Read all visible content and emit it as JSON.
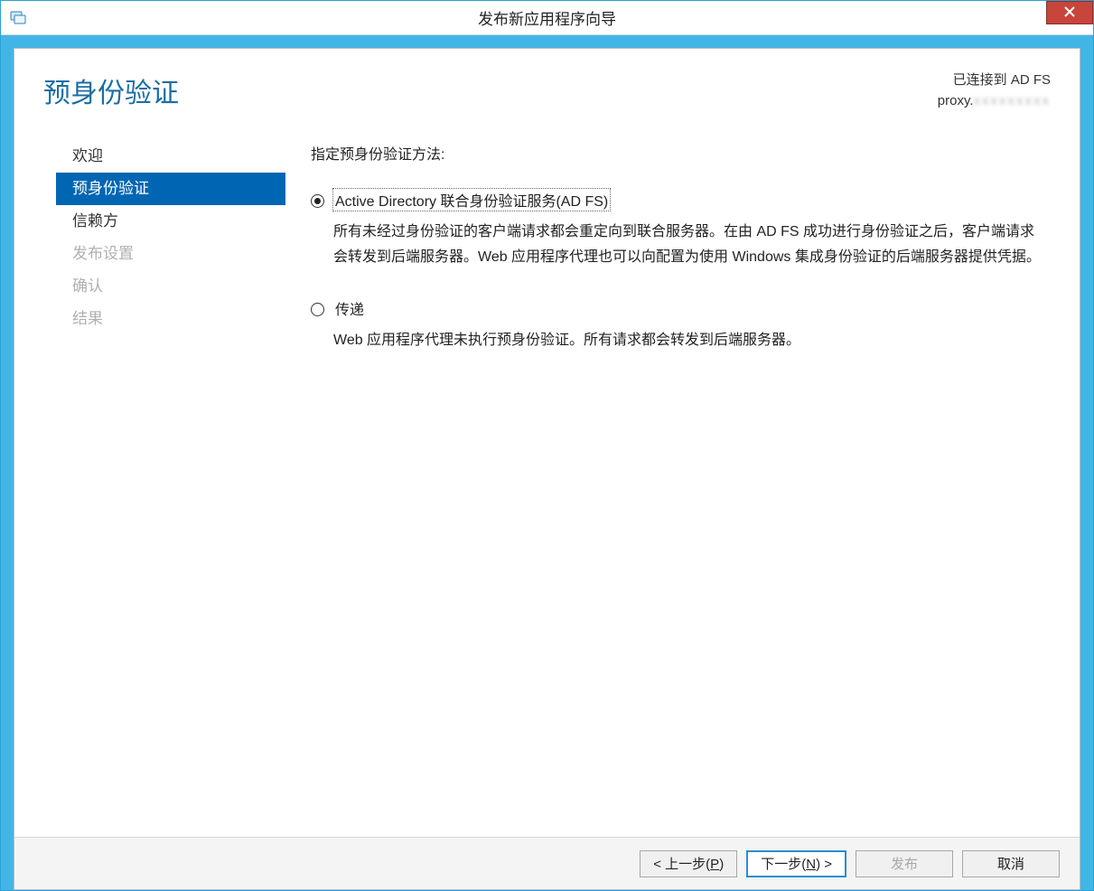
{
  "window": {
    "title": "发布新应用程序向导"
  },
  "header": {
    "page_title": "预身份验证",
    "status_line1": "已连接到 AD FS",
    "status_line2_prefix": "proxy."
  },
  "sidebar": {
    "steps": [
      {
        "label": "欢迎",
        "state": "done"
      },
      {
        "label": "预身份验证",
        "state": "active"
      },
      {
        "label": "信赖方",
        "state": "done"
      },
      {
        "label": "发布设置",
        "state": "disabled"
      },
      {
        "label": "确认",
        "state": "disabled"
      },
      {
        "label": "结果",
        "state": "disabled"
      }
    ]
  },
  "content": {
    "instruction": "指定预身份验证方法:",
    "options": [
      {
        "id": "adfs",
        "label": "Active Directory 联合身份验证服务(AD FS)",
        "description": "所有未经过身份验证的客户端请求都会重定向到联合服务器。在由 AD FS 成功进行身份验证之后，客户端请求会转发到后端服务器。Web 应用程序代理也可以向配置为使用 Windows 集成身份验证的后端服务器提供凭据。",
        "selected": true
      },
      {
        "id": "passthrough",
        "label": "传递",
        "description": "Web 应用程序代理未执行预身份验证。所有请求都会转发到后端服务器。",
        "selected": false
      }
    ]
  },
  "footer": {
    "prev": {
      "prefix": "< 上一步(",
      "hotkey": "P",
      "suffix": ")"
    },
    "next": {
      "prefix": "下一步(",
      "hotkey": "N",
      "suffix": ") >"
    },
    "publish_label": "发布",
    "cancel_label": "取消"
  }
}
